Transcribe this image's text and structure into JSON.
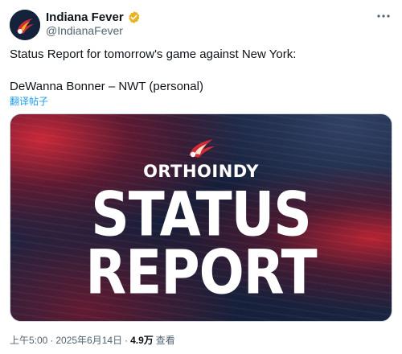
{
  "author": {
    "display_name": "Indiana Fever",
    "handle": "@IndianaFever",
    "verified": true,
    "avatar_icon": "indiana-fever-logo-icon"
  },
  "more_icon": "more-horizontal-icon",
  "tweet": {
    "text": "Status Report for tomorrow's game against New York:\n\nDeWanna Bonner – NWT (personal)",
    "translate_link": "翻译帖子"
  },
  "media": {
    "sponsor": "ORTHOINDY",
    "headline_line1": "STATUS",
    "headline_line2": "REPORT",
    "logo_icon": "fever-flame-logo-icon",
    "colors": {
      "background": "#17213d",
      "accent_red": "#d12a38",
      "text": "#ffffff"
    }
  },
  "footer": {
    "time": "上午5:00",
    "sep1": "·",
    "date": "2025年6月14日",
    "sep2": "·",
    "views": "4.9万",
    "views_label": "查看"
  },
  "colors": {
    "link": "#1d9bf0",
    "secondary_text": "#536471",
    "verified_badge": "#e8b31e"
  }
}
